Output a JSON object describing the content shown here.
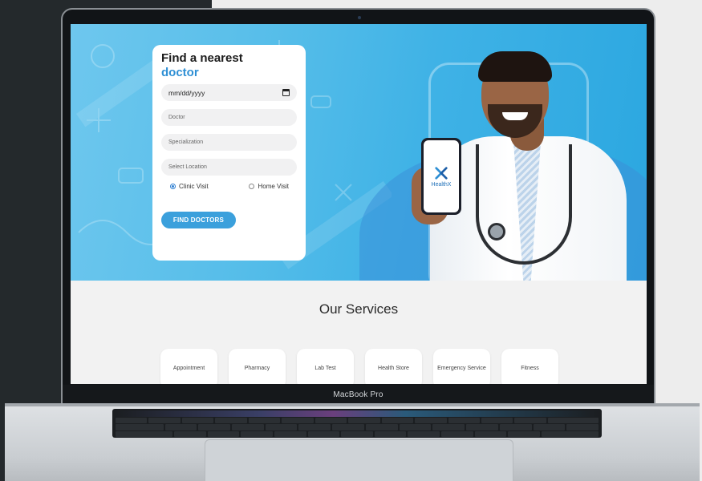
{
  "device": {
    "label": "MacBook Pro"
  },
  "search_card": {
    "title_line1": "Find a nearest",
    "title_line2": "doctor",
    "date_placeholder": "mm/dd/yyyy",
    "doctor_placeholder": "Doctor",
    "specialization_placeholder": "Specialization",
    "location_placeholder": "Select Location",
    "visit_options": [
      {
        "label": "Clinic Visit",
        "selected": true
      },
      {
        "label": "Home Visit",
        "selected": false
      }
    ],
    "submit_label": "FIND DOCTORS"
  },
  "hero": {
    "app_name": "HealthX"
  },
  "services": {
    "title": "Our Services",
    "items": [
      "Appointment",
      "Pharmacy",
      "Lab Test",
      "Health Store",
      "Emergency Service",
      "Fitness"
    ]
  },
  "colors": {
    "accent": "#2e8fd4",
    "hero_bg": "#4ab8e8",
    "button": "#3ba0dc"
  },
  "icons": {
    "date_picker": "calendar-icon",
    "app_logo": "healthx-x-logo"
  }
}
